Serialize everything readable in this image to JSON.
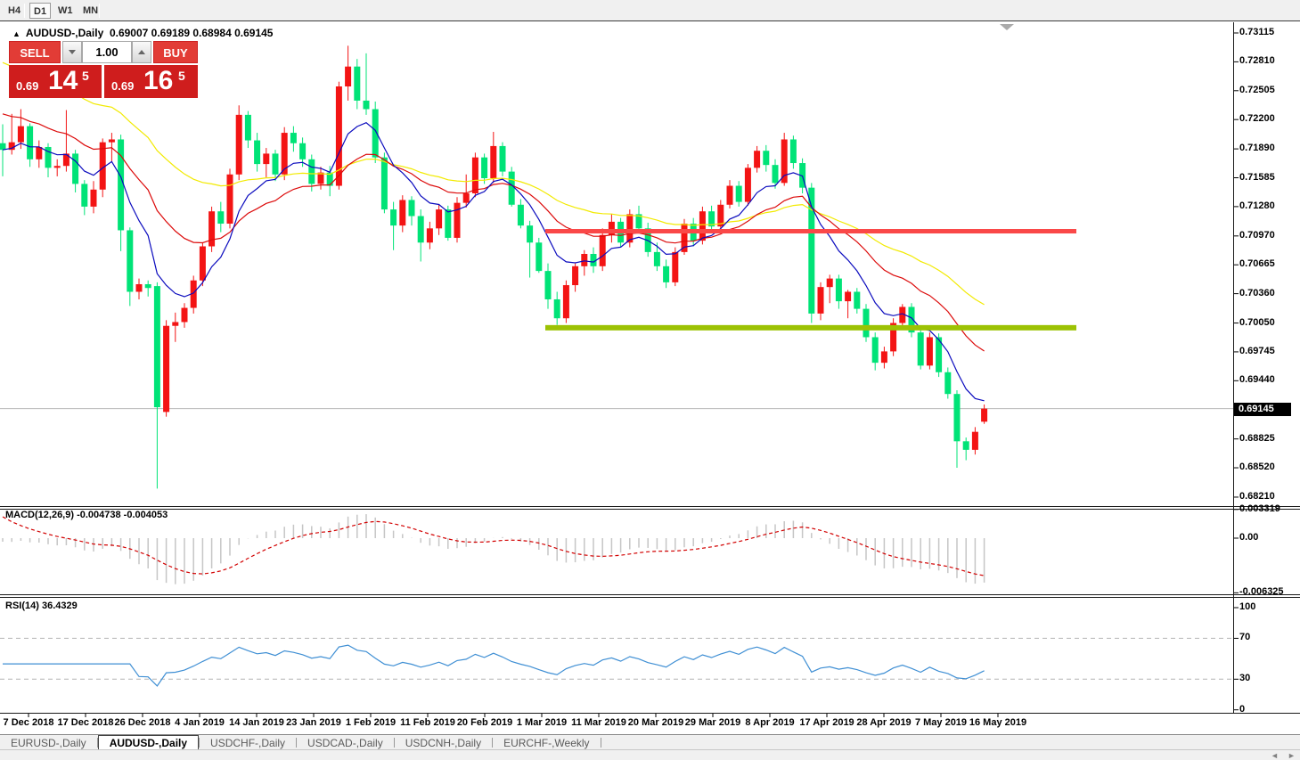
{
  "toolbar": {
    "timeframes": [
      {
        "label": "H4",
        "active": false
      },
      {
        "label": "D1",
        "active": true
      },
      {
        "label": "W1",
        "active": false
      },
      {
        "label": "MN",
        "active": false
      }
    ]
  },
  "chart": {
    "title": "AUDUSD-,Daily",
    "ohlc": "0.69007 0.69189 0.68984 0.69145"
  },
  "icons": {
    "collapse_triangle": "▲",
    "tab_scroll_left": "◄",
    "tab_scroll_right": "►"
  },
  "trade": {
    "sell_label": "SELL",
    "buy_label": "BUY",
    "volume": "1.00",
    "sell_price_small": "0.69",
    "sell_price_big": "14",
    "sell_price_sup": "5",
    "buy_price_small": "0.69",
    "buy_price_big": "16",
    "buy_price_sup": "5"
  },
  "price_axis": {
    "ticks": [
      "0.73115",
      "0.72810",
      "0.72505",
      "0.72200",
      "0.71890",
      "0.71585",
      "0.71280",
      "0.70970",
      "0.70665",
      "0.70360",
      "0.70050",
      "0.69745",
      "0.69440",
      "0.68825",
      "0.68520",
      "0.68210"
    ],
    "current_price": "0.69145"
  },
  "macd_panel": {
    "label": "MACD(12,26,9) -0.004738 -0.004053",
    "axis": [
      "0.003319",
      "0.00",
      "-0.006325"
    ]
  },
  "rsi_panel": {
    "label": "RSI(14) 36.4329",
    "axis": [
      "100",
      "70",
      "30",
      "0"
    ]
  },
  "date_axis": [
    "7 Dec 2018",
    "17 Dec 2018",
    "26 Dec 2018",
    "4 Jan 2019",
    "14 Jan 2019",
    "23 Jan 2019",
    "1 Feb 2019",
    "11 Feb 2019",
    "20 Feb 2019",
    "1 Mar 2019",
    "11 Mar 2019",
    "20 Mar 2019",
    "29 Mar 2019",
    "8 Apr 2019",
    "17 Apr 2019",
    "28 Apr 2019",
    "7 May 2019",
    "16 May 2019"
  ],
  "bottom_tabs": [
    {
      "label": "EURUSD-,Daily",
      "active": false
    },
    {
      "label": "AUDUSD-,Daily",
      "active": true
    },
    {
      "label": "USDCHF-,Daily",
      "active": false
    },
    {
      "label": "USDCAD-,Daily",
      "active": false
    },
    {
      "label": "USDCNH-,Daily",
      "active": false
    },
    {
      "label": "EURCHF-,Weekly",
      "active": false
    }
  ],
  "chart_data": {
    "type": "candlestick",
    "symbol": "AUDUSD",
    "timeframe": "Daily",
    "title": "AUDUSD-,Daily",
    "open": 0.69007,
    "high": 0.69189,
    "low": 0.68984,
    "close": 0.69145,
    "price_axis_range": [
      0.68116,
      0.73228
    ],
    "colors": {
      "bull_candle": "#f31414",
      "bear_candle": "#00e377",
      "ma_fast_blue": "#0b0bbe",
      "ma_mid_red": "#dc0a0a",
      "ma_slow_yellow": "#f2ea00",
      "resistance_line": "#fa4848",
      "support_line": "#9cc204",
      "current_price_line": "#b8b8b8",
      "macd_histogram": "#c6c6c6",
      "macd_signal": "#d20000",
      "rsi_line": "#3f8fd4"
    },
    "hlines": [
      {
        "name": "resistance",
        "price": 0.7102,
        "color": "#fa4848",
        "thickness": 5
      },
      {
        "name": "support",
        "price": 0.7,
        "color": "#9cc204",
        "thickness": 6
      }
    ],
    "current_price": 0.69145,
    "indicators": {
      "macd": {
        "params": "12,26,9",
        "value": -0.004738,
        "signal": -0.004053,
        "scale_top": 0.003319,
        "scale_bottom": -0.006325
      },
      "rsi": {
        "period": 14,
        "value": 36.4329,
        "levels": [
          70,
          30
        ]
      }
    },
    "candles": [
      [
        0.7195,
        0.7215,
        0.716,
        0.7188
      ],
      [
        0.7188,
        0.7226,
        0.7183,
        0.7196
      ],
      [
        0.7196,
        0.7231,
        0.7189,
        0.7213
      ],
      [
        0.7213,
        0.7216,
        0.717,
        0.7178
      ],
      [
        0.7178,
        0.7198,
        0.7169,
        0.7191
      ],
      [
        0.7191,
        0.7195,
        0.7159,
        0.7169
      ],
      [
        0.7169,
        0.7178,
        0.716,
        0.7171
      ],
      [
        0.7171,
        0.723,
        0.7165,
        0.7184
      ],
      [
        0.7184,
        0.7188,
        0.7143,
        0.7152
      ],
      [
        0.7152,
        0.7156,
        0.7119,
        0.7128
      ],
      [
        0.7128,
        0.7155,
        0.7121,
        0.7146
      ],
      [
        0.7146,
        0.72,
        0.7138,
        0.7196
      ],
      [
        0.7196,
        0.7206,
        0.7176,
        0.7199
      ],
      [
        0.7199,
        0.7204,
        0.7081,
        0.7103
      ],
      [
        0.7103,
        0.7106,
        0.7023,
        0.7038
      ],
      [
        0.7038,
        0.7052,
        0.703,
        0.7046
      ],
      [
        0.7046,
        0.705,
        0.7033,
        0.7042
      ],
      [
        0.7044,
        0.7048,
        0.683,
        0.6916
      ],
      [
        0.6911,
        0.7008,
        0.6906,
        0.7002
      ],
      [
        0.7002,
        0.7016,
        0.6985,
        0.7006
      ],
      [
        0.7006,
        0.7026,
        0.7,
        0.7021
      ],
      [
        0.7021,
        0.7055,
        0.7015,
        0.705
      ],
      [
        0.705,
        0.709,
        0.7044,
        0.7086
      ],
      [
        0.7086,
        0.7128,
        0.708,
        0.7123
      ],
      [
        0.7123,
        0.7133,
        0.7101,
        0.711
      ],
      [
        0.711,
        0.7168,
        0.7105,
        0.7162
      ],
      [
        0.7162,
        0.7235,
        0.7156,
        0.7225
      ],
      [
        0.7225,
        0.7229,
        0.719,
        0.7198
      ],
      [
        0.7198,
        0.7206,
        0.7165,
        0.7173
      ],
      [
        0.7173,
        0.719,
        0.7159,
        0.7184
      ],
      [
        0.7184,
        0.7188,
        0.7155,
        0.7162
      ],
      [
        0.7162,
        0.7212,
        0.7156,
        0.7206
      ],
      [
        0.7206,
        0.7213,
        0.7186,
        0.7195
      ],
      [
        0.7195,
        0.7201,
        0.717,
        0.7178
      ],
      [
        0.7178,
        0.7183,
        0.7144,
        0.7152
      ],
      [
        0.7152,
        0.717,
        0.7146,
        0.7164
      ],
      [
        0.7164,
        0.7171,
        0.7139,
        0.715
      ],
      [
        0.715,
        0.726,
        0.7146,
        0.7255
      ],
      [
        0.7255,
        0.7298,
        0.724,
        0.7276
      ],
      [
        0.7276,
        0.7284,
        0.7231,
        0.724
      ],
      [
        0.724,
        0.729,
        0.7225,
        0.7231
      ],
      [
        0.7231,
        0.7239,
        0.7174,
        0.718
      ],
      [
        0.718,
        0.7185,
        0.7121,
        0.7125
      ],
      [
        0.7125,
        0.7133,
        0.7082,
        0.7108
      ],
      [
        0.7108,
        0.714,
        0.7101,
        0.7135
      ],
      [
        0.7135,
        0.7139,
        0.7108,
        0.7118
      ],
      [
        0.7118,
        0.7125,
        0.707,
        0.709
      ],
      [
        0.709,
        0.7112,
        0.7083,
        0.7105
      ],
      [
        0.7105,
        0.713,
        0.7098,
        0.7125
      ],
      [
        0.7125,
        0.7129,
        0.7092,
        0.7095
      ],
      [
        0.7095,
        0.7138,
        0.709,
        0.7132
      ],
      [
        0.7132,
        0.7162,
        0.7127,
        0.7142
      ],
      [
        0.7142,
        0.7185,
        0.7138,
        0.718
      ],
      [
        0.718,
        0.7184,
        0.7152,
        0.7158
      ],
      [
        0.7158,
        0.7207,
        0.7153,
        0.7192
      ],
      [
        0.7192,
        0.7196,
        0.716,
        0.7165
      ],
      [
        0.7165,
        0.717,
        0.7128,
        0.713
      ],
      [
        0.713,
        0.7136,
        0.7105,
        0.7108
      ],
      [
        0.7108,
        0.7113,
        0.7053,
        0.709
      ],
      [
        0.709,
        0.7095,
        0.7058,
        0.706
      ],
      [
        0.706,
        0.7068,
        0.702,
        0.703
      ],
      [
        0.703,
        0.7038,
        0.7003,
        0.701
      ],
      [
        0.701,
        0.705,
        0.7005,
        0.7045
      ],
      [
        0.7045,
        0.7068,
        0.7038,
        0.7065
      ],
      [
        0.7065,
        0.7082,
        0.7055,
        0.7078
      ],
      [
        0.7078,
        0.7085,
        0.7058,
        0.7065
      ],
      [
        0.7065,
        0.7105,
        0.706,
        0.7098
      ],
      [
        0.7098,
        0.712,
        0.709,
        0.7112
      ],
      [
        0.7112,
        0.7116,
        0.7085,
        0.709
      ],
      [
        0.709,
        0.7125,
        0.7085,
        0.712
      ],
      [
        0.712,
        0.7129,
        0.71,
        0.7105
      ],
      [
        0.7105,
        0.7111,
        0.7075,
        0.708
      ],
      [
        0.708,
        0.709,
        0.706,
        0.7065
      ],
      [
        0.7065,
        0.7072,
        0.7042,
        0.7048
      ],
      [
        0.7048,
        0.7085,
        0.7044,
        0.708
      ],
      [
        0.708,
        0.7115,
        0.7077,
        0.711
      ],
      [
        0.711,
        0.7116,
        0.7086,
        0.7092
      ],
      [
        0.7092,
        0.7128,
        0.7088,
        0.7123
      ],
      [
        0.7123,
        0.7129,
        0.7102,
        0.7107
      ],
      [
        0.7107,
        0.7135,
        0.7103,
        0.713
      ],
      [
        0.713,
        0.7156,
        0.7126,
        0.715
      ],
      [
        0.715,
        0.7155,
        0.7128,
        0.7133
      ],
      [
        0.7133,
        0.7173,
        0.7129,
        0.7169
      ],
      [
        0.7169,
        0.7192,
        0.7164,
        0.7187
      ],
      [
        0.7187,
        0.7193,
        0.7165,
        0.7172
      ],
      [
        0.7172,
        0.7178,
        0.7147,
        0.7153
      ],
      [
        0.7153,
        0.7206,
        0.715,
        0.7199
      ],
      [
        0.7199,
        0.7203,
        0.7168,
        0.7174
      ],
      [
        0.7174,
        0.7179,
        0.7142,
        0.7148
      ],
      [
        0.7148,
        0.7153,
        0.7005,
        0.7015
      ],
      [
        0.7015,
        0.7048,
        0.7008,
        0.7043
      ],
      [
        0.7043,
        0.7056,
        0.7026,
        0.7052
      ],
      [
        0.7052,
        0.7056,
        0.702,
        0.7028
      ],
      [
        0.7028,
        0.704,
        0.701,
        0.7038
      ],
      [
        0.7038,
        0.7042,
        0.7015,
        0.702
      ],
      [
        0.702,
        0.7025,
        0.6985,
        0.699
      ],
      [
        0.699,
        0.6995,
        0.6955,
        0.6963
      ],
      [
        0.6963,
        0.698,
        0.6957,
        0.6975
      ],
      [
        0.6975,
        0.701,
        0.697,
        0.7005
      ],
      [
        0.7005,
        0.7025,
        0.7,
        0.7022
      ],
      [
        0.7022,
        0.7026,
        0.699,
        0.6995
      ],
      [
        0.6995,
        0.7,
        0.6956,
        0.696
      ],
      [
        0.696,
        0.6995,
        0.6956,
        0.699
      ],
      [
        0.699,
        0.6994,
        0.6948,
        0.6953
      ],
      [
        0.6953,
        0.6958,
        0.6925,
        0.693
      ],
      [
        0.693,
        0.6934,
        0.6852,
        0.688
      ],
      [
        0.688,
        0.6884,
        0.686,
        0.6871
      ],
      [
        0.6871,
        0.6895,
        0.6866,
        0.689
      ],
      [
        0.69007,
        0.69189,
        0.68984,
        0.69145
      ]
    ]
  }
}
